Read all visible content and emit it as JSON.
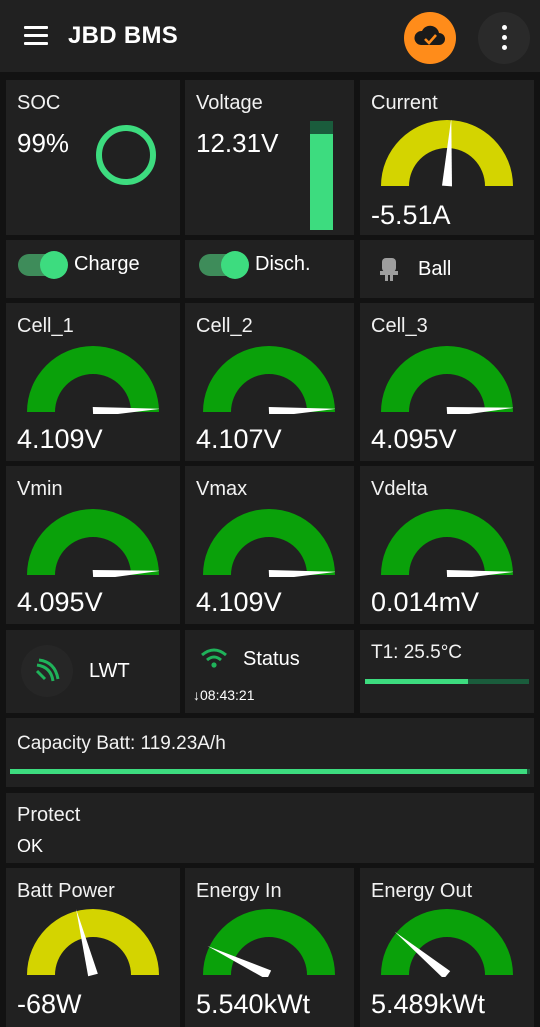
{
  "app": {
    "title": "JBD BMS"
  },
  "colors": {
    "accent": "#3ddc7f",
    "cloud": "#ff8c1a",
    "gauge_green": "#0aa10a",
    "gauge_yellow": "#d4d400"
  },
  "top": {
    "soc": {
      "label": "SOC",
      "value": "99%",
      "percent": 99
    },
    "voltage": {
      "label": "Voltage",
      "value": "12.31V",
      "level_fraction": 0.88
    },
    "current": {
      "label": "Current",
      "value": "-5.51A",
      "gauge_fraction": 0.52
    }
  },
  "toggles": {
    "charge": {
      "label": "Charge",
      "on": true
    },
    "discharge": {
      "label": "Disch.",
      "on": true
    },
    "balance": {
      "label": "Ball",
      "icon": "plug-icon"
    }
  },
  "cells": [
    {
      "label": "Cell_1",
      "value": "4.109V",
      "gauge_fraction": 0.985
    },
    {
      "label": "Cell_2",
      "value": "4.107V",
      "gauge_fraction": 0.985
    },
    {
      "label": "Cell_3",
      "value": "4.095V",
      "gauge_fraction": 0.98
    }
  ],
  "stats": [
    {
      "label": "Vmin",
      "value": "4.095V",
      "gauge_fraction": 0.98
    },
    {
      "label": "Vmax",
      "value": "4.109V",
      "gauge_fraction": 0.985
    },
    {
      "label": "Vdelta",
      "value": "0.014mV",
      "gauge_fraction": 0.985
    }
  ],
  "status_row": {
    "lwt": {
      "label": "LWT",
      "icon": "signal-icon"
    },
    "wifi": {
      "label": "Status",
      "time": "↓08:43:21",
      "icon": "wifi-icon"
    },
    "temp": {
      "label": "T1: 25.5°C",
      "level_fraction": 0.63
    }
  },
  "capacity": {
    "label": "Capacity Batt: 119.23A/h",
    "level_fraction": 0.995
  },
  "protect": {
    "label": "Protect",
    "value": "OK"
  },
  "bottom": [
    {
      "label": "Batt Power",
      "value": "-68W",
      "gauge_fraction": 0.42,
      "color": "yellow"
    },
    {
      "label": "Energy In",
      "value": "5.540kWt",
      "gauge_fraction": 0.14,
      "color": "green"
    },
    {
      "label": "Energy Out",
      "value": "5.489kWt",
      "gauge_fraction": 0.22,
      "color": "green"
    }
  ]
}
